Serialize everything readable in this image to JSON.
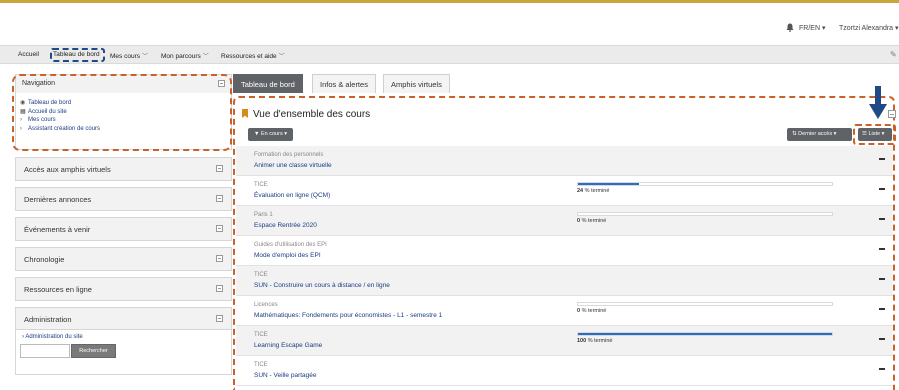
{
  "userbar": {
    "lang": "FR/EN",
    "user": "Tzortzi Alexandra"
  },
  "navbar": {
    "items": [
      {
        "label": "Accueil",
        "dropdown": false
      },
      {
        "label": "Tableau de bord",
        "dropdown": false
      },
      {
        "label": "Mes cours",
        "dropdown": true
      },
      {
        "label": "Mon parcours",
        "dropdown": true
      },
      {
        "label": "Ressources et aide",
        "dropdown": true
      }
    ]
  },
  "sidebar": {
    "navigation": {
      "title": "Navigation",
      "items": [
        {
          "label": "Tableau de bord",
          "icon": "dashboard-icon"
        },
        {
          "label": "Accueil du site",
          "icon": "site-icon"
        },
        {
          "label": "Mes cours",
          "icon": "chevron-right-icon"
        },
        {
          "label": "Assistant création de cours",
          "icon": "chevron-right-icon"
        }
      ]
    },
    "blocks": [
      {
        "title": "Accès aux amphis virtuels"
      },
      {
        "title": "Dernières annonces"
      },
      {
        "title": "Événements à venir"
      },
      {
        "title": "Chronologie"
      },
      {
        "title": "Ressources en ligne"
      }
    ],
    "admin": {
      "title": "Administration",
      "link": "Administration du site",
      "search_value": "",
      "search_button": "Rechercher"
    }
  },
  "tabs": [
    {
      "label": "Tableau de bord",
      "active": true
    },
    {
      "label": "Infos & alertes",
      "active": false
    },
    {
      "label": "Amphis virtuels",
      "active": false
    }
  ],
  "overview": {
    "title": "Vue d'ensemble des cours",
    "filter_label": "En cours",
    "sort_label": "Dernier accès",
    "view_label": "Liste"
  },
  "courses": [
    {
      "category": "Formation des personnels",
      "name": "Animer une classe virtuelle",
      "progress": null,
      "progress_text": ""
    },
    {
      "category": "TICE",
      "name": "Évaluation en ligne (QCM)",
      "progress": 24,
      "progress_text": "24",
      "progress_suffix": "% terminé"
    },
    {
      "category": "Paris 1",
      "name": "Espace Rentrée 2020",
      "progress": 0,
      "progress_text": "0",
      "progress_suffix": "% terminé"
    },
    {
      "category": "Guides d'utilisation des EPI",
      "name": "Mode d'emploi des EPI",
      "progress": null,
      "progress_text": ""
    },
    {
      "category": "TICE",
      "name": "SUN - Construire un cours à distance / en ligne",
      "progress": null,
      "progress_text": ""
    },
    {
      "category": "Licences",
      "name": "Mathématiques: Fondements pour économistes - L1 - semestre 1",
      "progress": 0,
      "progress_text": "0",
      "progress_suffix": "% terminé"
    },
    {
      "category": "TICE",
      "name": "Learning Escape Game",
      "progress": 100,
      "progress_text": "100",
      "progress_suffix": "% terminé"
    },
    {
      "category": "TICE",
      "name": "SUN - Veille partagée",
      "progress": null,
      "progress_text": ""
    }
  ],
  "colors": {
    "accent_gold": "#c8a63c",
    "highlight_orange": "#c9622a",
    "highlight_blue": "#1e4a86",
    "progress_blue": "#2a6ec2",
    "button_grey": "#5f6368"
  }
}
